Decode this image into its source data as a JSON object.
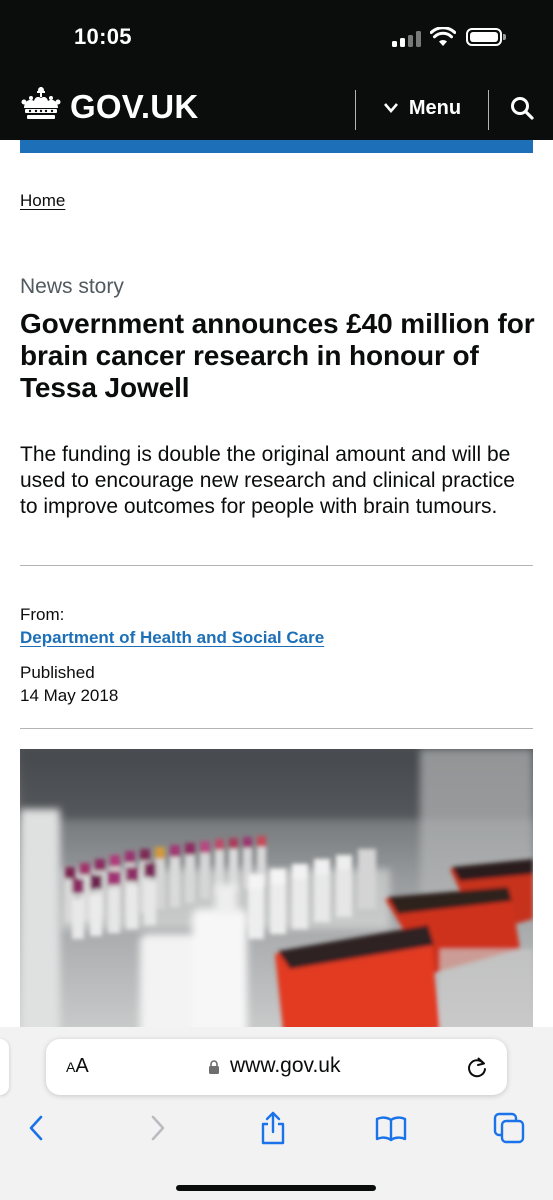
{
  "status_bar": {
    "time": "10:05"
  },
  "header": {
    "logo_text": "GOV.UK",
    "menu_label": "Menu"
  },
  "breadcrumb": {
    "home": "Home"
  },
  "article": {
    "caption": "News story",
    "title": "Government announces £40 million for brain cancer research in honour of Tessa Jowell",
    "lead": "The funding is double the original amount and will be used to encourage new research and clinical practice to improve outcomes for people with brain tumours.",
    "from_label": "From:",
    "from_org": "Department of Health and Social Care",
    "published_label": "Published",
    "published_date": "14 May 2018"
  },
  "browser": {
    "aa_big": "A",
    "aa_small": "A",
    "url": "www.gov.uk"
  },
  "colors": {
    "header_bg": "#0b0c0c",
    "brand_blue": "#1d70b8",
    "link_blue": "#1d70b8",
    "ios_blue": "#1a73e8"
  },
  "icons": {
    "logo": "crown-icon",
    "menu": "chevron-down-icon",
    "search": "search-icon",
    "lock": "lock-icon",
    "reload": "reload-icon",
    "back": "back-icon",
    "forward": "forward-icon",
    "share": "share-icon",
    "bookmarks": "bookmarks-icon",
    "tabs": "tabs-icon"
  }
}
